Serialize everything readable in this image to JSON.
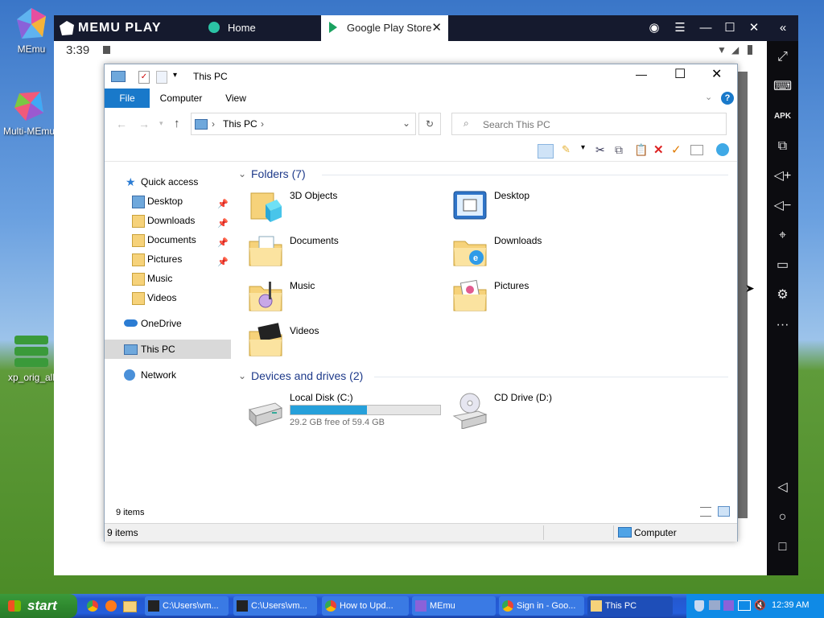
{
  "desktop": {
    "icons": [
      {
        "label": "MEmu"
      },
      {
        "label": "Multi-MEmu"
      },
      {
        "label": "xp_orig_all"
      }
    ]
  },
  "emulator": {
    "brand": "MEMU PLAY",
    "tabs": [
      {
        "label": "Home"
      },
      {
        "label": "Google Play Store"
      }
    ],
    "clock": "3:39",
    "side_icons": [
      "fullscreen-icon",
      "keyboard-icon",
      "apk-icon",
      "screenshot-icon",
      "volume-up-icon",
      "volume-down-icon",
      "location-icon",
      "folder-icon",
      "gear-icon",
      "more-icon",
      "back-icon",
      "home-icon",
      "recents-icon"
    ]
  },
  "explorer": {
    "title": "This PC",
    "ribbon_tabs": [
      "File",
      "Computer",
      "View"
    ],
    "breadcrumb": "This PC",
    "search_placeholder": "Search This PC",
    "nav": {
      "quick_access": "Quick access",
      "items": [
        {
          "label": "Desktop",
          "pinned": true
        },
        {
          "label": "Downloads",
          "pinned": true
        },
        {
          "label": "Documents",
          "pinned": true
        },
        {
          "label": "Pictures",
          "pinned": true
        },
        {
          "label": "Music",
          "pinned": false
        },
        {
          "label": "Videos",
          "pinned": false
        }
      ],
      "onedrive": "OneDrive",
      "this_pc": "This PC",
      "network": "Network"
    },
    "folders_header": "Folders (7)",
    "folders": [
      {
        "label": "3D Objects"
      },
      {
        "label": "Desktop"
      },
      {
        "label": "Documents"
      },
      {
        "label": "Downloads"
      },
      {
        "label": "Music"
      },
      {
        "label": "Pictures"
      },
      {
        "label": "Videos"
      }
    ],
    "drives_header": "Devices and drives (2)",
    "drives": [
      {
        "label": "Local Disk (C:)",
        "free": "29.2 GB free of 59.4 GB",
        "used_fraction": 0.51
      },
      {
        "label": "CD Drive (D:)"
      }
    ],
    "item_count": "9 items",
    "status_location": "Computer"
  },
  "taskbar": {
    "start": "start",
    "tasks": [
      {
        "label": "C:\\Users\\vm..."
      },
      {
        "label": "C:\\Users\\vm..."
      },
      {
        "label": "How to Upd..."
      },
      {
        "label": "MEmu"
      },
      {
        "label": "Sign in - Goo..."
      },
      {
        "label": "This PC"
      }
    ],
    "time": "12:39 AM"
  },
  "colors": {
    "ribbon_file_tab": "#1979ca",
    "emulator_bar": "#151a2e",
    "taskbar": "#245edb",
    "start_button": "#2f8a2f",
    "disk_bar": "#26a0da"
  }
}
